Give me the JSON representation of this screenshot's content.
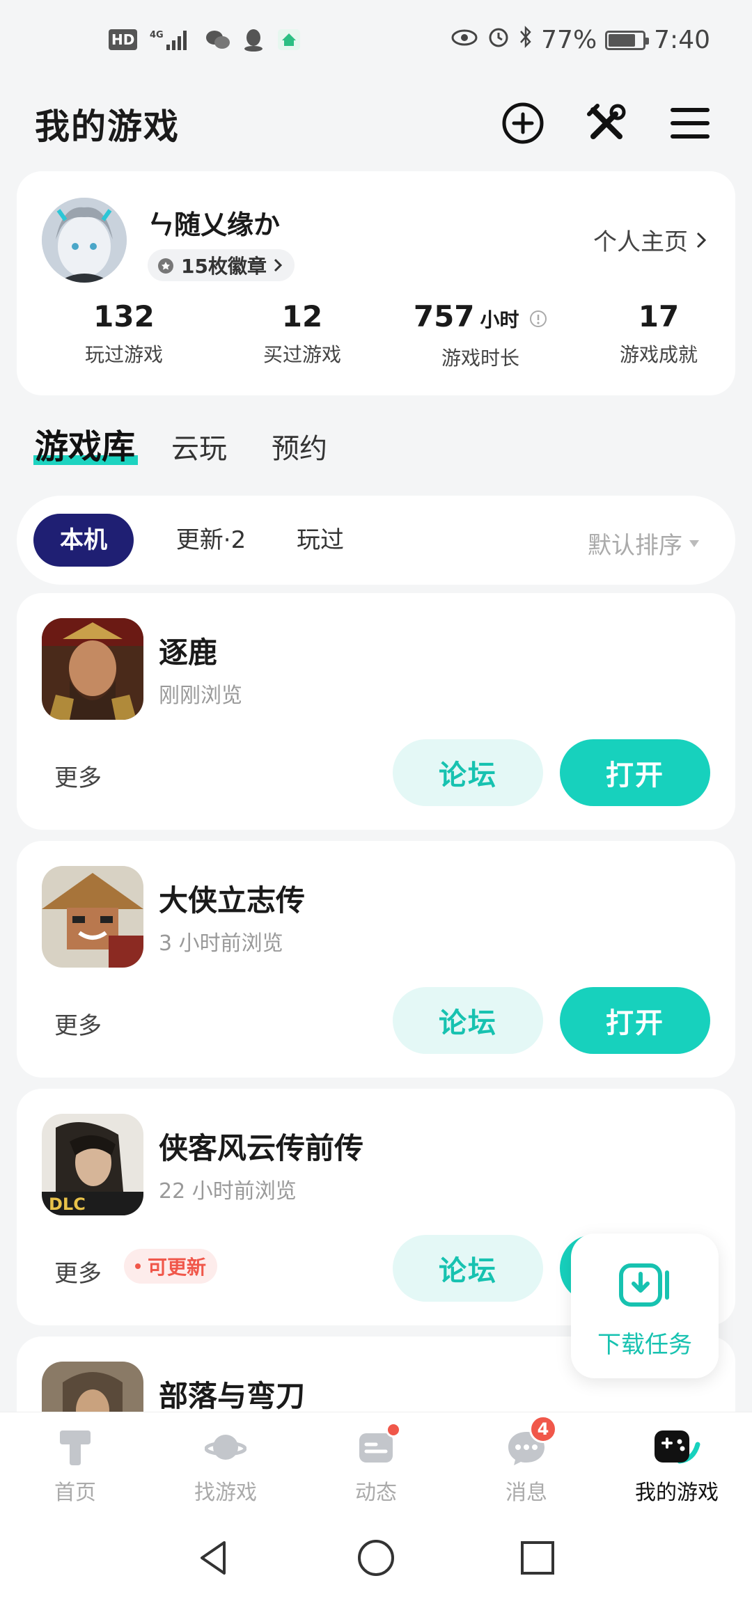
{
  "status_bar": {
    "hd": "HD",
    "net": "4G",
    "eye_alarm_bt": "",
    "battery": "77%",
    "time": "7:40"
  },
  "header": {
    "title": "我的游戏"
  },
  "profile": {
    "username": "ㄣ随乂缘か",
    "badges": "15枚徽章",
    "homepage_link": "个人主页",
    "stats": [
      {
        "value": "132",
        "unit": "",
        "label": "玩过游戏"
      },
      {
        "value": "12",
        "unit": "",
        "label": "买过游戏"
      },
      {
        "value": "757",
        "unit": "小时",
        "label": "游戏时长"
      },
      {
        "value": "17",
        "unit": "",
        "label": "游戏成就"
      }
    ]
  },
  "section_tabs": [
    "游戏库",
    "云玩",
    "预约"
  ],
  "filter": {
    "chips": [
      "本机",
      "更新·2",
      "玩过"
    ],
    "sort": "默认排序"
  },
  "games": [
    {
      "name": "逐鹿",
      "sub": "刚刚浏览",
      "more": "更多",
      "forum": "论坛",
      "open": "打开",
      "update": ""
    },
    {
      "name": "大侠立志传",
      "sub": "3 小时前浏览",
      "more": "更多",
      "forum": "论坛",
      "open": "打开",
      "update": ""
    },
    {
      "name": "侠客风云传前传",
      "sub": "22 小时前浏览",
      "more": "更多",
      "forum": "论坛",
      "open": "打开",
      "update": "可更新"
    },
    {
      "name": "部落与弯刀",
      "sub": "",
      "more": "",
      "forum": "",
      "open": "",
      "update": ""
    }
  ],
  "download_float": {
    "label": "下载任务"
  },
  "bottom_nav": {
    "items": [
      {
        "label": "首页",
        "icon": "home-icon"
      },
      {
        "label": "找游戏",
        "icon": "planet-icon"
      },
      {
        "label": "动态",
        "icon": "feed-icon"
      },
      {
        "label": "消息",
        "icon": "message-icon",
        "count": "4"
      },
      {
        "label": "我的游戏",
        "icon": "gamepad-icon"
      }
    ]
  },
  "colors": {
    "accent": "#17d1bd",
    "accent_text": "#17c2b0",
    "chip_active": "#1f1f73",
    "alert": "#f0574a"
  }
}
